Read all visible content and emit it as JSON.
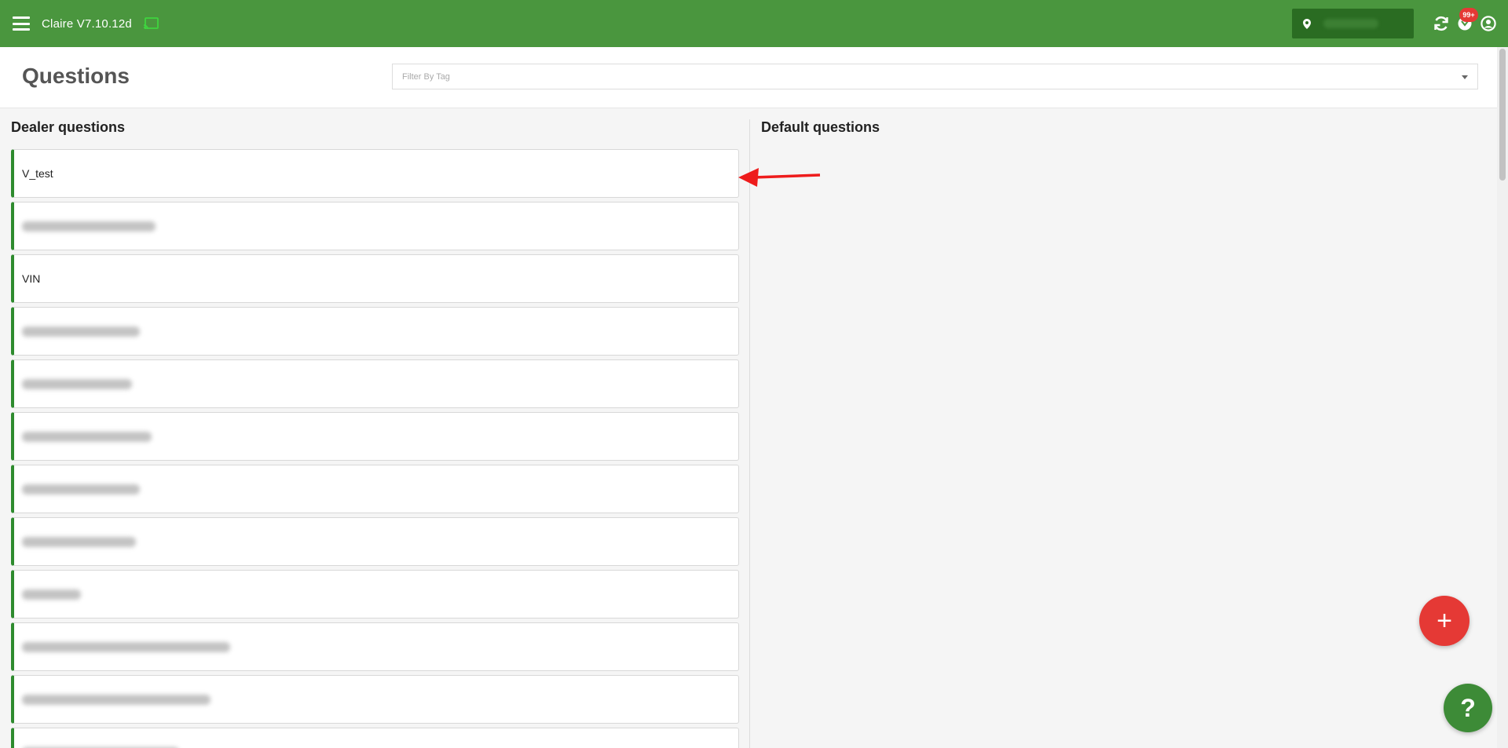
{
  "app": {
    "title": "Claire V7.10.12d"
  },
  "topbar": {
    "icons": [
      "menu-icon",
      "cast-icon",
      "location-pin-icon",
      "sync-icon",
      "notifications-icon",
      "account-icon"
    ],
    "notification_badge": "99+"
  },
  "page": {
    "title": "Questions"
  },
  "filter": {
    "placeholder": "Filter By Tag"
  },
  "dealer": {
    "heading": "Dealer questions",
    "items": [
      {
        "label": "V_test",
        "redacted": false
      },
      {
        "label": "",
        "redacted": true
      },
      {
        "label": "VIN",
        "redacted": false
      },
      {
        "label": "",
        "redacted": true
      },
      {
        "label": "",
        "redacted": true
      },
      {
        "label": "",
        "redacted": true
      },
      {
        "label": "",
        "redacted": true
      },
      {
        "label": "",
        "redacted": true
      },
      {
        "label": "",
        "redacted": true
      },
      {
        "label": "",
        "redacted": true
      },
      {
        "label": "",
        "redacted": true
      },
      {
        "label": "",
        "redacted": true
      }
    ]
  },
  "default": {
    "heading": "Default questions"
  },
  "fab": {
    "add": "+",
    "help": "?"
  },
  "colors": {
    "topbar": "#4a963e",
    "accent": "#2e8b2e",
    "fab_add": "#e53935",
    "fab_help": "#3d8b37"
  }
}
